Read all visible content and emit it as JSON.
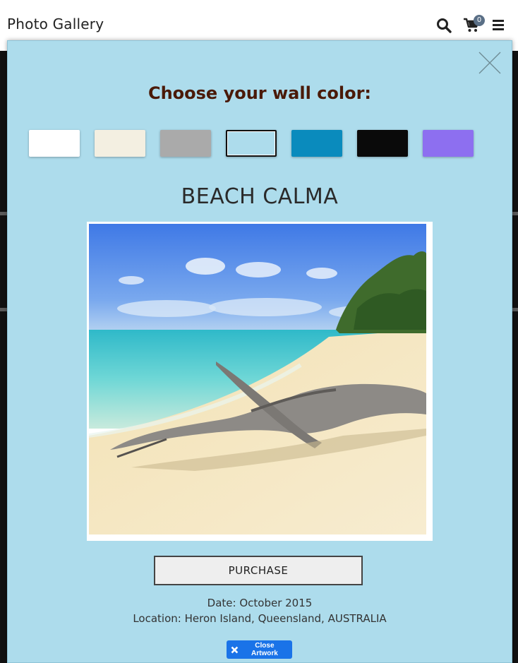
{
  "header": {
    "brand": "Photo Gallery",
    "cart_count": "0",
    "icons": [
      "search-icon",
      "cart-icon",
      "menu-icon"
    ]
  },
  "modal": {
    "title": "Choose your wall color:",
    "swatches": [
      {
        "name": "white",
        "color": "#ffffff"
      },
      {
        "name": "cream",
        "color": "#f3efe1"
      },
      {
        "name": "gray",
        "color": "#aaaaaa"
      },
      {
        "name": "light-blue",
        "color": "#addcec",
        "selected": true
      },
      {
        "name": "teal-blue",
        "color": "#0a8bbd"
      },
      {
        "name": "black",
        "color": "#0a0a0a"
      },
      {
        "name": "purple",
        "color": "#8d6ff0"
      }
    ],
    "artwork_title": "BEACH CALMA",
    "purchase_label": "PURCHASE",
    "date": "Date: October 2015",
    "location": "Location: Heron Island, Queensland, AUSTRALIA",
    "close_artwork_label": "Close Artwork"
  }
}
